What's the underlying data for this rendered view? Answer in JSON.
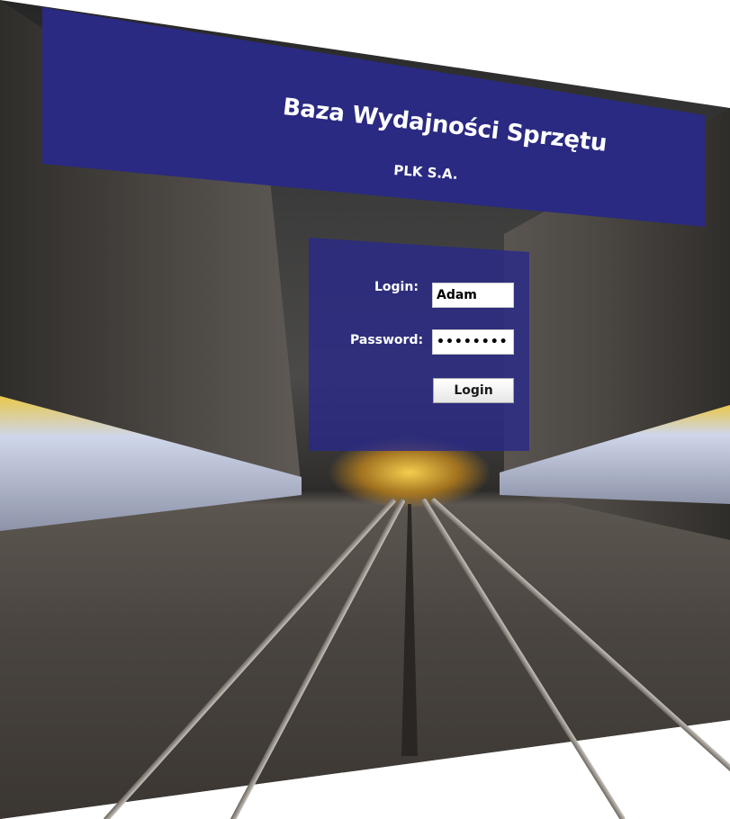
{
  "header": {
    "title": "Baza Wydajności Sprzętu",
    "subtitle": "PLK S.A."
  },
  "login_form": {
    "login_label": "Login:",
    "login_value": "Adam",
    "password_label": "Password:",
    "password_value": "••••••••",
    "submit_label": "Login"
  },
  "colors": {
    "banner": "#2a2a82",
    "panel": "#28288c",
    "text": "#ffffff"
  }
}
